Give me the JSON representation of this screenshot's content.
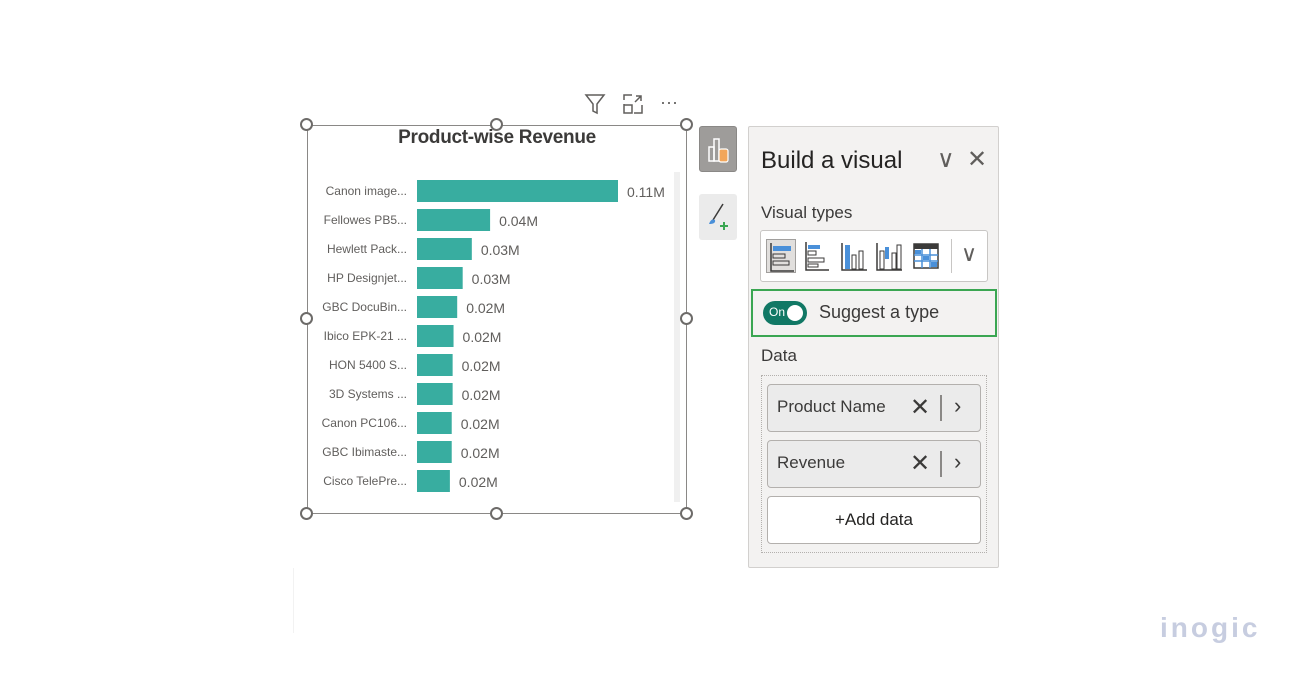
{
  "visual_header": {
    "icons": [
      "filter-icon",
      "focus-mode-icon",
      "more-options-icon"
    ],
    "more_glyph": "···"
  },
  "chart_data": {
    "type": "bar",
    "orientation": "horizontal",
    "title": "Product-wise Revenue",
    "xlabel": "",
    "ylabel": "",
    "categories": [
      "Canon image...",
      "Fellowes PB5...",
      "Hewlett Pack...",
      "HP Designjet...",
      "GBC DocuBin...",
      "Ibico EPK-21 ...",
      "HON 5400 S...",
      "3D Systems ...",
      "Canon PC106...",
      "GBC Ibimaste...",
      "Cisco TelePre..."
    ],
    "values": [
      0.11,
      0.04,
      0.03,
      0.025,
      0.022,
      0.02,
      0.0195,
      0.0195,
      0.019,
      0.019,
      0.018
    ],
    "data_labels": [
      "0.11M",
      "0.04M",
      "0.03M",
      "0.03M",
      "0.02M",
      "0.02M",
      "0.02M",
      "0.02M",
      "0.02M",
      "0.02M",
      "0.02M"
    ],
    "unit": "M",
    "xlim": [
      0,
      0.11
    ],
    "bar_color": "#38ada0",
    "grid": false,
    "legend": "none"
  },
  "side_buttons": {
    "build": "build-visual-icon",
    "format": "format-visual-icon"
  },
  "pane": {
    "title": "Build a visual",
    "collapse_glyph": "∨",
    "close_glyph": "✕",
    "visual_types_label": "Visual types",
    "visual_types": [
      "stacked-bar-chart",
      "clustered-bar-chart",
      "stacked-column-chart",
      "clustered-column-chart",
      "table"
    ],
    "selected_visual_type": "stacked-bar-chart",
    "more_types_glyph": "∨",
    "suggest": {
      "toggle_state": "On",
      "label": "Suggest a type"
    },
    "data_label": "Data",
    "fields": [
      {
        "name": "Product Name",
        "remove_glyph": "✕",
        "expand_glyph": "›"
      },
      {
        "name": "Revenue",
        "remove_glyph": "✕",
        "expand_glyph": "›"
      }
    ],
    "add_data_label": "+Add data"
  },
  "brand": {
    "text": "inogic"
  }
}
